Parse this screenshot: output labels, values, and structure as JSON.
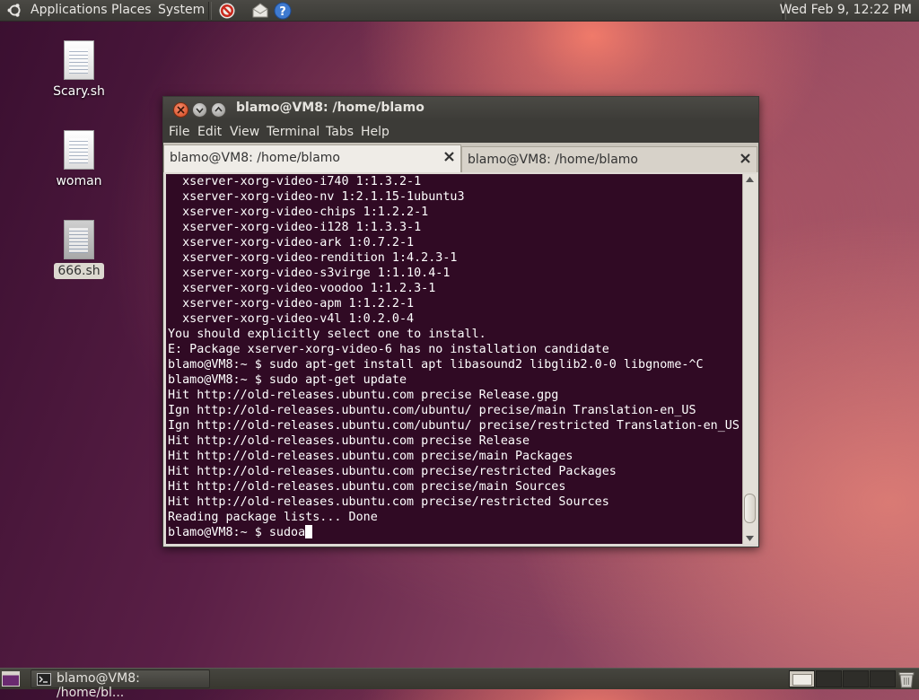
{
  "top_panel": {
    "menus": [
      "Applications",
      "Places",
      "System"
    ],
    "launchers": [
      "no-entry-icon",
      "mail-icon",
      "help-icon"
    ],
    "clock": "Wed Feb  9, 12:22 PM"
  },
  "desktop_icons": [
    {
      "label": "Scary.sh",
      "icon": "text-file-icon",
      "selected": false
    },
    {
      "label": "woman",
      "icon": "text-file-icon",
      "selected": false
    },
    {
      "label": "666.sh",
      "icon": "script-file-icon",
      "selected": true
    }
  ],
  "terminal": {
    "title": "blamo@VM8: /home/blamo",
    "menu": [
      "File",
      "Edit",
      "View",
      "Terminal",
      "Tabs",
      "Help"
    ],
    "tabs": [
      {
        "label": "blamo@VM8: /home/blamo",
        "active": true
      },
      {
        "label": "blamo@VM8: /home/blamo",
        "active": false
      }
    ],
    "lines": [
      "  xserver-xorg-video-i740 1:1.3.2-1",
      "  xserver-xorg-video-nv 1:2.1.15-1ubuntu3",
      "  xserver-xorg-video-chips 1:1.2.2-1",
      "  xserver-xorg-video-i128 1:1.3.3-1",
      "  xserver-xorg-video-ark 1:0.7.2-1",
      "  xserver-xorg-video-rendition 1:4.2.3-1",
      "  xserver-xorg-video-s3virge 1:1.10.4-1",
      "  xserver-xorg-video-voodoo 1:1.2.3-1",
      "  xserver-xorg-video-apm 1:1.2.2-1",
      "  xserver-xorg-video-v4l 1:0.2.0-4",
      "You should explicitly select one to install.",
      "E: Package xserver-xorg-video-6 has no installation candidate",
      "blamo@VM8:~ $ sudo apt-get install apt libasound2 libglib2.0-0 libgnome-^C",
      "blamo@VM8:~ $ sudo apt-get update",
      "Hit http://old-releases.ubuntu.com precise Release.gpg",
      "Ign http://old-releases.ubuntu.com/ubuntu/ precise/main Translation-en_US",
      "Ign http://old-releases.ubuntu.com/ubuntu/ precise/restricted Translation-en_US",
      "Hit http://old-releases.ubuntu.com precise Release",
      "Hit http://old-releases.ubuntu.com precise/main Packages",
      "Hit http://old-releases.ubuntu.com precise/restricted Packages",
      "Hit http://old-releases.ubuntu.com precise/main Sources",
      "Hit http://old-releases.ubuntu.com precise/restricted Sources",
      "Reading package lists... Done"
    ],
    "prompt_line": "blamo@VM8:~ $ sudoa",
    "colors": {
      "background": "#300a24",
      "text": "#ffffff"
    }
  },
  "bottom_panel": {
    "task_label": "blamo@VM8: /home/bl...",
    "workspaces": 4,
    "active_workspace": 1
  }
}
